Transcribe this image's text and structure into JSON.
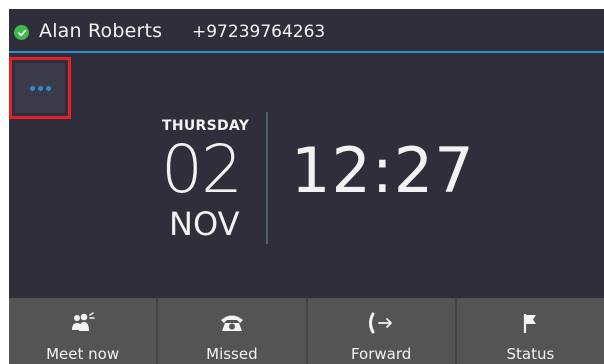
{
  "header": {
    "user_name": "Alan Roberts",
    "phone_number": "+97239764263",
    "status_color": "#3dbb4a",
    "accent_color": "#2a8fcf"
  },
  "more_button": {
    "icon": "more-dots-icon",
    "highlight_color": "#e4202a"
  },
  "clock": {
    "day": "THURSDAY",
    "date": "02",
    "month": "NOV",
    "time": "12:27"
  },
  "softkeys": [
    {
      "label": "Meet now",
      "icon": "meet-now-icon"
    },
    {
      "label": "Missed",
      "icon": "missed-call-icon"
    },
    {
      "label": "Forward",
      "icon": "forward-icon"
    },
    {
      "label": "Status",
      "icon": "status-flag-icon"
    }
  ]
}
